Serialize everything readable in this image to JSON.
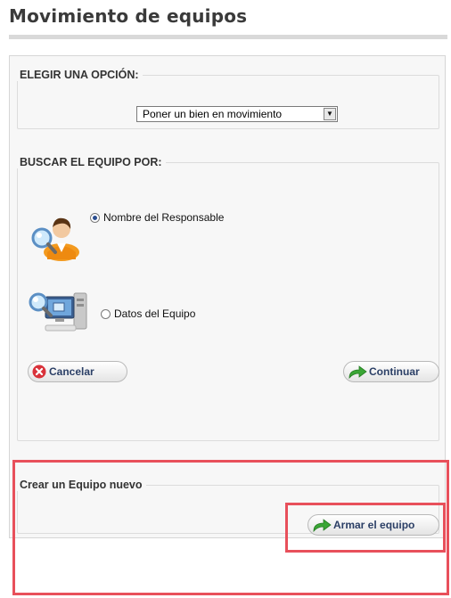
{
  "header": {
    "title": "Movimiento de equipos"
  },
  "option_section": {
    "legend": "ELEGIR UNA OPCIÓN:",
    "select_value": "Poner un bien en movimiento"
  },
  "search_section": {
    "legend": "BUSCAR EL EQUIPO POR:",
    "options": [
      {
        "label": "Nombre del Responsable",
        "checked": true,
        "icon": "user-search-icon"
      },
      {
        "label": "Datos del Equipo",
        "checked": false,
        "icon": "computer-search-icon"
      }
    ],
    "cancel_label": "Cancelar",
    "continue_label": "Continuar"
  },
  "create_section": {
    "legend": "Crear un Equipo nuevo",
    "build_label": "Armar el equipo"
  },
  "colors": {
    "highlight": "#e8505b",
    "cancel_icon": "#d9323a",
    "arrow_icon": "#3aa635",
    "button_text": "#2b3f66"
  }
}
